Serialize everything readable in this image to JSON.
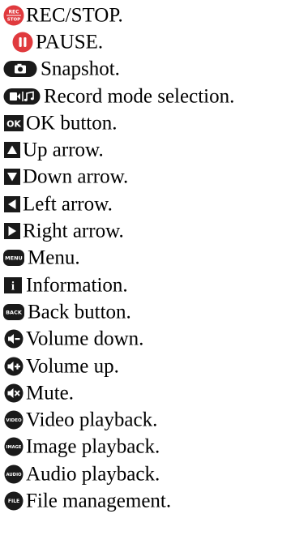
{
  "legend": {
    "items": [
      {
        "icon": "rec-stop-icon",
        "label": "REC/STOP.",
        "icon_text_top": "REC",
        "icon_text_bottom": "STOP"
      },
      {
        "icon": "pause-icon",
        "label": "PAUSE."
      },
      {
        "icon": "camera-icon",
        "label": "Snapshot."
      },
      {
        "icon": "record-mode-icon",
        "label": "Record mode selection."
      },
      {
        "icon": "ok-icon",
        "label": "OK button.",
        "icon_text": "OK"
      },
      {
        "icon": "up-arrow-icon",
        "label": "Up arrow."
      },
      {
        "icon": "down-arrow-icon",
        "label": "Down arrow."
      },
      {
        "icon": "left-arrow-icon",
        "label": "Left arrow."
      },
      {
        "icon": "right-arrow-icon",
        "label": "Right arrow."
      },
      {
        "icon": "menu-icon",
        "label": "Menu.",
        "icon_text": "MENU"
      },
      {
        "icon": "info-icon",
        "label": "Information.",
        "icon_text": "i"
      },
      {
        "icon": "back-icon",
        "label": "Back button.",
        "icon_text": "BACK"
      },
      {
        "icon": "volume-down-icon",
        "label": "Volume down."
      },
      {
        "icon": "volume-up-icon",
        "label": "Volume up."
      },
      {
        "icon": "mute-icon",
        "label": "Mute."
      },
      {
        "icon": "video-playback-icon",
        "label": "Video playback.",
        "icon_text": "VIDEO"
      },
      {
        "icon": "image-playback-icon",
        "label": "Image playback.",
        "icon_text": "IMAGE"
      },
      {
        "icon": "audio-playback-icon",
        "label": "Audio playback.",
        "icon_text": "AUDIO"
      },
      {
        "icon": "file-management-icon",
        "label": "File management.",
        "icon_text": "FILE"
      }
    ]
  },
  "colors": {
    "rec_red": "#e03a3e",
    "dark": "#1a1a1a",
    "text": "#000000"
  }
}
